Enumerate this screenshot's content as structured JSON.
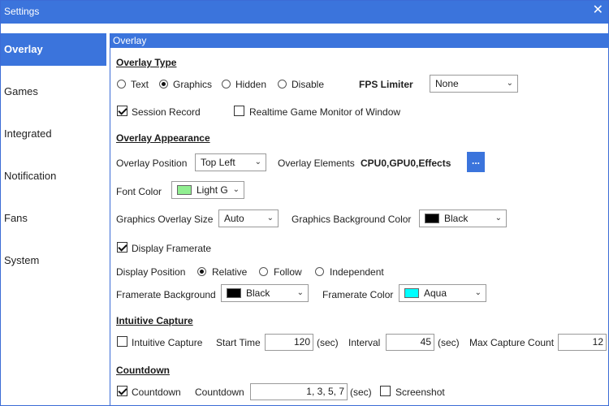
{
  "window": {
    "title": "Settings",
    "close_label": "✕"
  },
  "sidebar": {
    "items": [
      {
        "label": "Overlay"
      },
      {
        "label": "Games"
      },
      {
        "label": "Integrated"
      },
      {
        "label": "Notification"
      },
      {
        "label": "Fans"
      },
      {
        "label": "System"
      }
    ]
  },
  "panel": {
    "header": "Overlay"
  },
  "overlay_type": {
    "title": "Overlay Type",
    "options": [
      "Text",
      "Graphics",
      "Hidden",
      "Disable"
    ],
    "selected": "Graphics",
    "fps_limiter_label": "FPS Limiter",
    "fps_limiter_value": "None",
    "session_record_label": "Session Record",
    "session_record_checked": true,
    "realtime_monitor_label": "Realtime Game Monitor of Window",
    "realtime_monitor_checked": false
  },
  "appearance": {
    "title": "Overlay Appearance",
    "position_label": "Overlay Position",
    "position_value": "Top Left",
    "elements_label": "Overlay Elements",
    "elements_value": "CPU0,GPU0,Effects",
    "elements_button": "...",
    "font_color_label": "Font Color",
    "font_color_value": "Light G",
    "font_color_swatch": "#90ee90",
    "size_label": "Graphics Overlay Size",
    "size_value": "Auto",
    "bg_color_label": "Graphics Background Color",
    "bg_color_value": "Black",
    "bg_color_swatch": "#000000",
    "display_framerate_label": "Display Framerate",
    "display_framerate_checked": true,
    "display_position_label": "Display Position",
    "display_position_options": [
      "Relative",
      "Follow",
      "Independent"
    ],
    "display_position_selected": "Relative",
    "framerate_bg_label": "Framerate Background",
    "framerate_bg_value": "Black",
    "framerate_bg_swatch": "#000000",
    "framerate_color_label": "Framerate Color",
    "framerate_color_value": "Aqua",
    "framerate_color_swatch": "#00ffff"
  },
  "capture": {
    "title": "Intuitive Capture",
    "capture_label": "Intuitive Capture",
    "capture_checked": false,
    "start_time_label": "Start Time",
    "start_time_value": "120",
    "start_time_unit": "(sec)",
    "interval_label": "Interval",
    "interval_value": "45",
    "interval_unit": "(sec)",
    "max_count_label": "Max Capture Count",
    "max_count_value": "12"
  },
  "countdown": {
    "title": "Countdown",
    "countdown_check_label": "Countdown",
    "countdown_checked": true,
    "countdown_field_label": "Countdown",
    "countdown_value": "1, 3, 5, 7",
    "countdown_unit": "(sec)",
    "screenshot_label": "Screenshot",
    "screenshot_checked": false
  },
  "colors": {
    "accent": "#3b74dc"
  }
}
